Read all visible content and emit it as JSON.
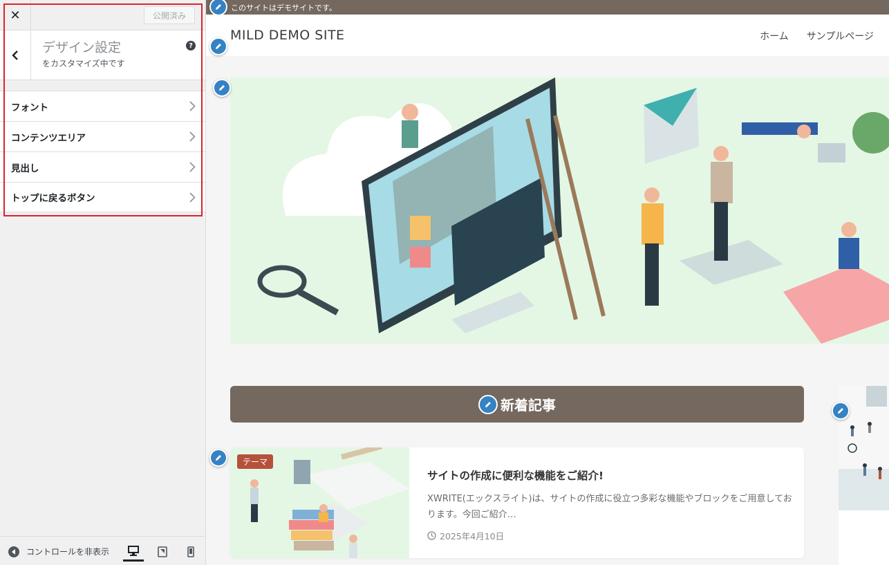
{
  "customizer": {
    "close_label": "✕",
    "publish_label": "公開済み",
    "panel": {
      "title": "デザイン設定",
      "subtitle": "をカスタマイズ中です",
      "help": "?"
    },
    "items": [
      {
        "label": "フォント"
      },
      {
        "label": "コンテンツエリア"
      },
      {
        "label": "見出し"
      },
      {
        "label": "トップに戻るボタン"
      }
    ],
    "footer": {
      "hide_controls_label": "コントロールを非表示",
      "devices": [
        "desktop",
        "tablet",
        "mobile"
      ]
    },
    "highlight_color": "#d9232e"
  },
  "preview": {
    "demo_notice": "このサイトはデモサイトです。",
    "site_title": "MILD DEMO SITE",
    "nav": [
      "ホーム",
      "サンプルページ"
    ],
    "section_heading": "新着記事",
    "post": {
      "tag": "テーマ",
      "title": "サイトの作成に便利な機能をご紹介!",
      "excerpt": "XWRITE(エックスライト)は、サイトの作成に役立つ多彩な機能やブロックをご用意しております。今回ご紹介…",
      "date": "2025年4月10日"
    },
    "colors": {
      "brand_bar": "#74685f",
      "edit_pencil": "#3582c4",
      "hero_bg": "#e4f7e4",
      "tag_bg": "#b5513b"
    }
  }
}
